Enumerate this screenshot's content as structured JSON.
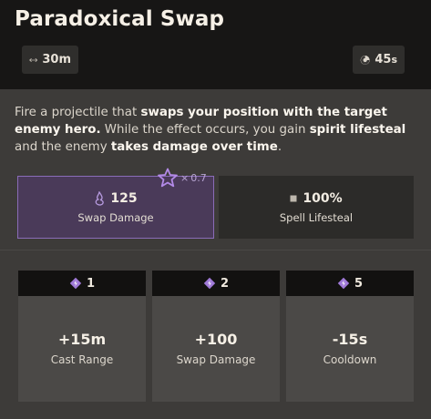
{
  "ability": {
    "title": "Paradoxical Swap",
    "range_value": "30m",
    "cooldown_value": "45",
    "cooldown_unit": "s"
  },
  "description": {
    "segments": [
      {
        "text": "Fire a projectile that ",
        "bold": false
      },
      {
        "text": "swaps your position with the target enemy hero.",
        "bold": true
      },
      {
        "text": " While the effect occurs, you gain ",
        "bold": false
      },
      {
        "text": "spirit lifesteal",
        "bold": true
      },
      {
        "text": " and the enemy ",
        "bold": false
      },
      {
        "text": "takes damage over time",
        "bold": true
      },
      {
        "text": ".",
        "bold": false
      }
    ]
  },
  "stats": {
    "swap_damage": {
      "value": "125",
      "label": "Swap Damage",
      "spirit_scaling": "0.7"
    },
    "spell_lifesteal": {
      "value": "100%",
      "label": "Spell Lifesteal"
    }
  },
  "upgrades": [
    {
      "tier": "1",
      "value": "+15m",
      "label": "Cast Range"
    },
    {
      "tier": "2",
      "value": "+100",
      "label": "Swap Damage"
    },
    {
      "tier": "5",
      "value": "-15s",
      "label": "Cooldown"
    }
  ],
  "colors": {
    "header_bg": "#171615",
    "body_bg": "#3d3b39",
    "spirit_purple": "#8a6cb8",
    "spirit_highlight": "#4a3a59"
  }
}
